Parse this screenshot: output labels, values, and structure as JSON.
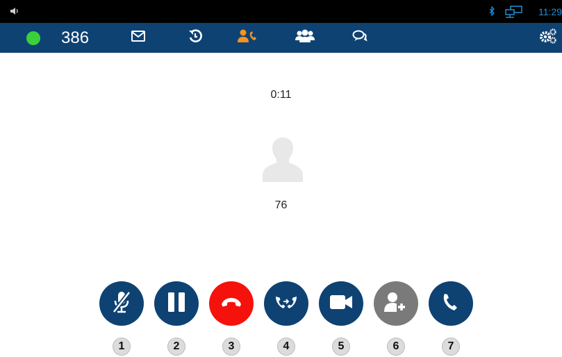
{
  "status_bar": {
    "clock": "11:29",
    "speaker_icon": "speaker-icon",
    "bluetooth_icon": "bluetooth-icon",
    "network_icon": "network-icon"
  },
  "nav": {
    "presence_color": "#3ccf3c",
    "extension": "386",
    "items": [
      {
        "name": "messages",
        "icon": "mail-icon"
      },
      {
        "name": "history",
        "icon": "history-icon"
      },
      {
        "name": "calls",
        "icon": "active-call-icon",
        "active": true
      },
      {
        "name": "contacts",
        "icon": "contacts-icon"
      },
      {
        "name": "chat",
        "icon": "chat-icon"
      },
      {
        "name": "settings",
        "icon": "settings-icon"
      }
    ],
    "active_color": "#f7931e"
  },
  "call": {
    "timer": "0:11",
    "caller": "76"
  },
  "actions": [
    {
      "name": "mute",
      "icon": "mic-off-icon",
      "badge": "1"
    },
    {
      "name": "hold",
      "icon": "pause-icon",
      "badge": "2"
    },
    {
      "name": "end-call",
      "icon": "hangup-icon",
      "badge": "3"
    },
    {
      "name": "transfer",
      "icon": "transfer-icon",
      "badge": "4"
    },
    {
      "name": "video",
      "icon": "video-icon",
      "badge": "5"
    },
    {
      "name": "add-participant",
      "icon": "add-user-icon",
      "badge": "6"
    },
    {
      "name": "new-call",
      "icon": "phone-icon",
      "badge": "7"
    }
  ],
  "colors": {
    "nav_bg": "#0e4273",
    "button_bg": "#0e4273",
    "end_call": "#f5120c",
    "disabled": "#7a7a7a"
  }
}
